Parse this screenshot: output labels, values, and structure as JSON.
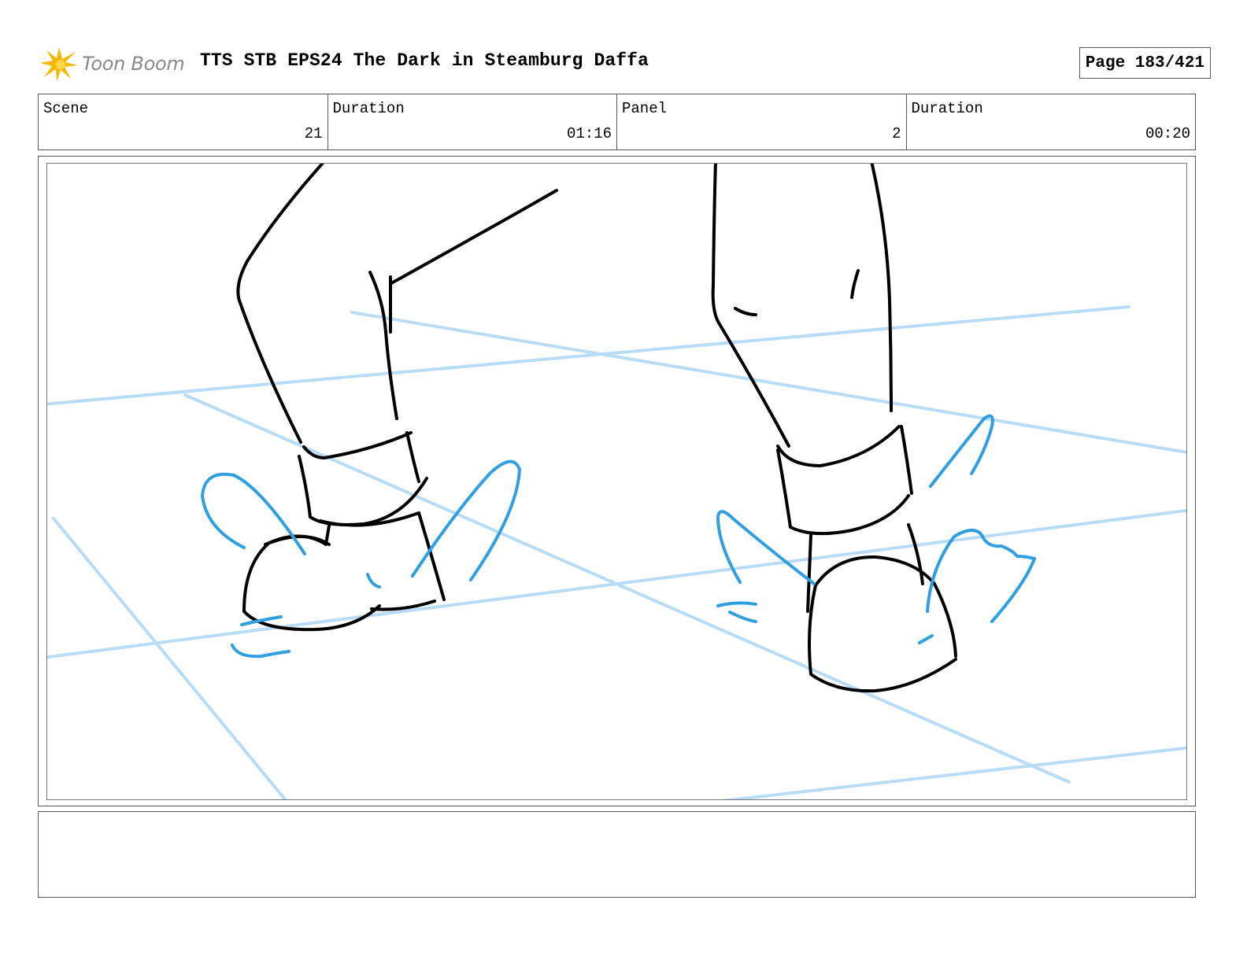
{
  "header": {
    "logo_text": "Toon Boom",
    "title": "TTS STB EPS24 The Dark in Steamburg Daffa",
    "page": "Page 183/421"
  },
  "info": {
    "scene_label": "Scene",
    "scene_value": "21",
    "scene_duration_label": "Duration",
    "scene_duration_value": "01:16",
    "panel_label": "Panel",
    "panel_value": "2",
    "panel_duration_label": "Duration",
    "panel_duration_value": "00:20"
  },
  "colors": {
    "logo_star": "#f5b800",
    "guide_lines": "#b8dcf5",
    "motion_marks": "#2f9fe0",
    "ink": "#000000"
  },
  "icons": {
    "logo": "sunburst-star-icon"
  },
  "notes": ""
}
